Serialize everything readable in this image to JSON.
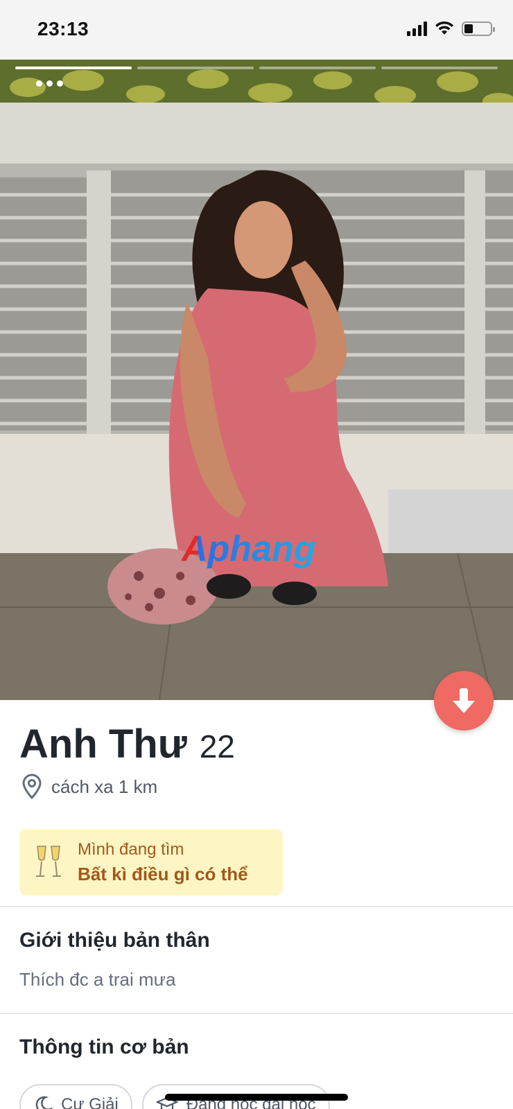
{
  "status_bar": {
    "time": "23:13"
  },
  "photo": {
    "page_count": 4,
    "active_page": 1,
    "watermark": "Aphang"
  },
  "profile": {
    "name": "Anh Thư",
    "age": "22",
    "distance": "cách xa 1 km",
    "looking_for": {
      "label": "Mình đang tìm",
      "value": "Bất kì điều gì có thể",
      "icon": "champagne-icon"
    }
  },
  "about": {
    "title": "Giới thiệu bản thân",
    "text": "Thích đc a trai mưa"
  },
  "basics": {
    "title": "Thông tin cơ bản",
    "chips": [
      {
        "icon": "moon-icon",
        "label": "Cự Giải"
      },
      {
        "icon": "graduation-cap-icon",
        "label": "Đang học đại học"
      }
    ]
  },
  "colors": {
    "accent": "#ef6a62",
    "looking_bg": "#fdf6c4",
    "looking_text": "#a3571b"
  }
}
